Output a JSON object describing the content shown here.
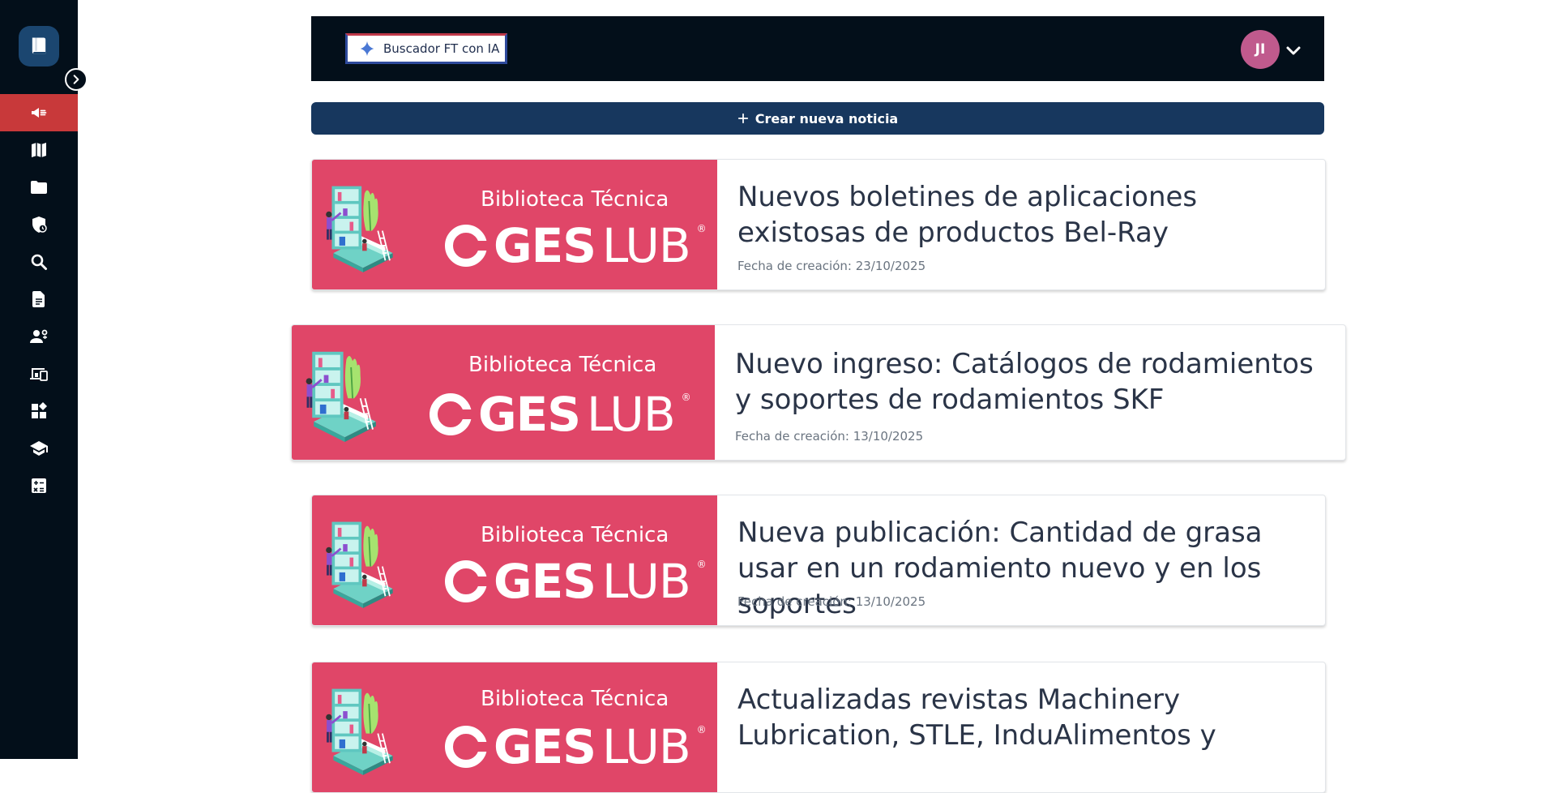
{
  "header": {
    "ai_search_label": "Buscador FT con IA",
    "avatar_initials": "JI"
  },
  "actions": {
    "create_news_label": "Crear nueva noticia"
  },
  "sidebar": {
    "items": [
      {
        "icon": "megaphone-icon",
        "active": true
      },
      {
        "icon": "map-icon"
      },
      {
        "icon": "folder-icon"
      },
      {
        "icon": "shield-clock-icon"
      },
      {
        "icon": "search-icon"
      },
      {
        "icon": "document-icon"
      },
      {
        "icon": "user-settings-icon"
      },
      {
        "icon": "devices-icon"
      },
      {
        "icon": "widgets-icon"
      },
      {
        "icon": "graduation-cap-icon"
      },
      {
        "icon": "calculator-icon"
      }
    ]
  },
  "news": [
    {
      "banner_title": "Biblioteca Técnica",
      "brand_bold": "GES",
      "brand_light": "LUB",
      "title": "Nuevos boletines de aplicaciones existosas de productos Bel-Ray",
      "date": "Fecha de creación: 23/10/2025"
    },
    {
      "banner_title": "Biblioteca Técnica",
      "brand_bold": "GES",
      "brand_light": "LUB",
      "title": "Nuevo ingreso: Catálogos de rodamientos y soportes de rodamientos SKF",
      "date": "Fecha de creación: 13/10/2025"
    },
    {
      "banner_title": "Biblioteca Técnica",
      "brand_bold": "GES",
      "brand_light": "LUB",
      "title": "Nueva publicación: Cantidad de grasa usar en un rodamiento nuevo y en los soportes",
      "date": "Fecha de creación: 13/10/2025"
    },
    {
      "banner_title": "Biblioteca Técnica",
      "brand_bold": "GES",
      "brand_light": "LUB",
      "title": "Actualizadas revistas Machinery Lubrication, STLE, InduAlimentos y",
      "date": ""
    }
  ],
  "colors": {
    "sidebar_bg": "#030f1a",
    "active_item": "#c8393a",
    "banner_bg": "#e04668",
    "create_button": "#17375e",
    "avatar": "#c05a8d"
  }
}
